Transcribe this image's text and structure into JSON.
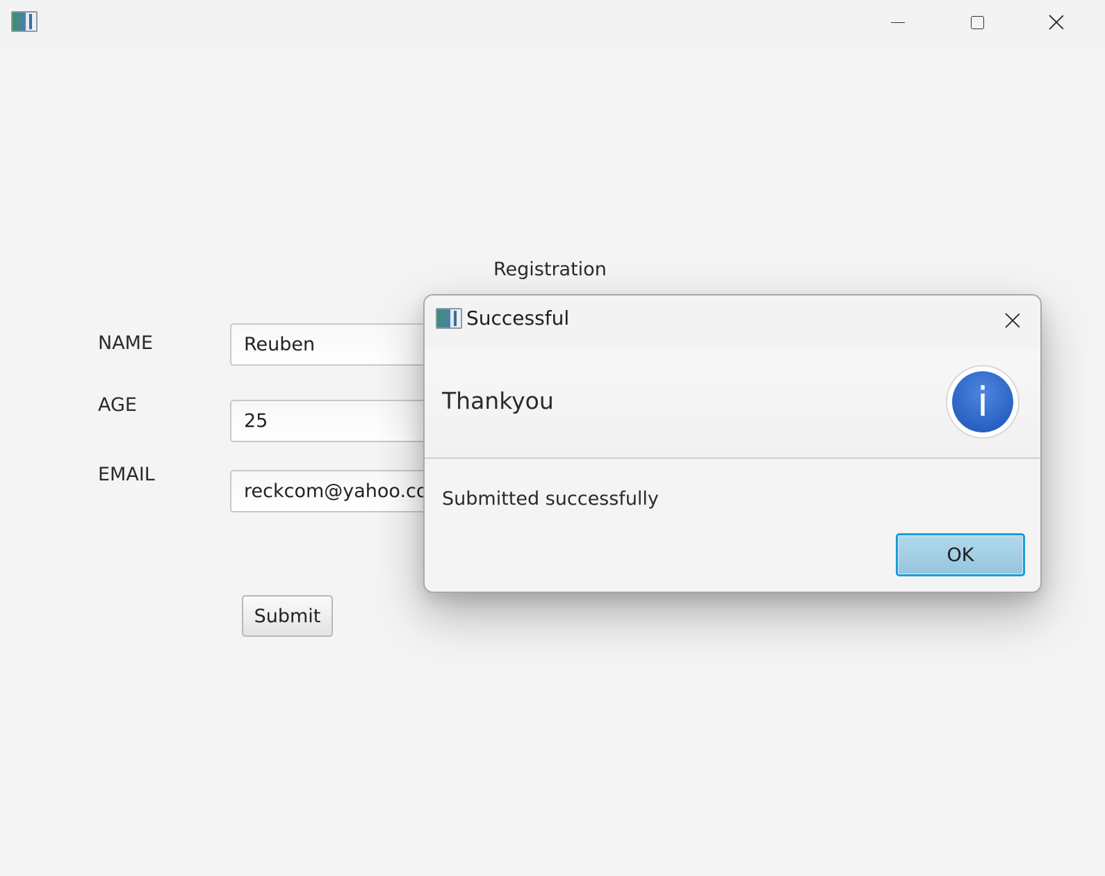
{
  "window": {
    "app_icon": "app-icon",
    "controls": [
      "minimize-icon",
      "maximize-icon",
      "close-icon"
    ]
  },
  "form": {
    "title": "Registration",
    "fields": [
      {
        "label": "NAME",
        "value": "Reuben"
      },
      {
        "label": "AGE",
        "value": "25"
      },
      {
        "label": "EMAIL",
        "value": "reckcom@yahoo.com"
      }
    ],
    "submit_label": "Submit"
  },
  "dialog": {
    "title": "Successful",
    "header": "Thankyou",
    "content": "Submitted successfully",
    "icon": "info-icon",
    "icon_glyph": "i",
    "ok_label": "OK",
    "accent_color": "#1c9bd8",
    "icon_color": "#2a62c4"
  }
}
